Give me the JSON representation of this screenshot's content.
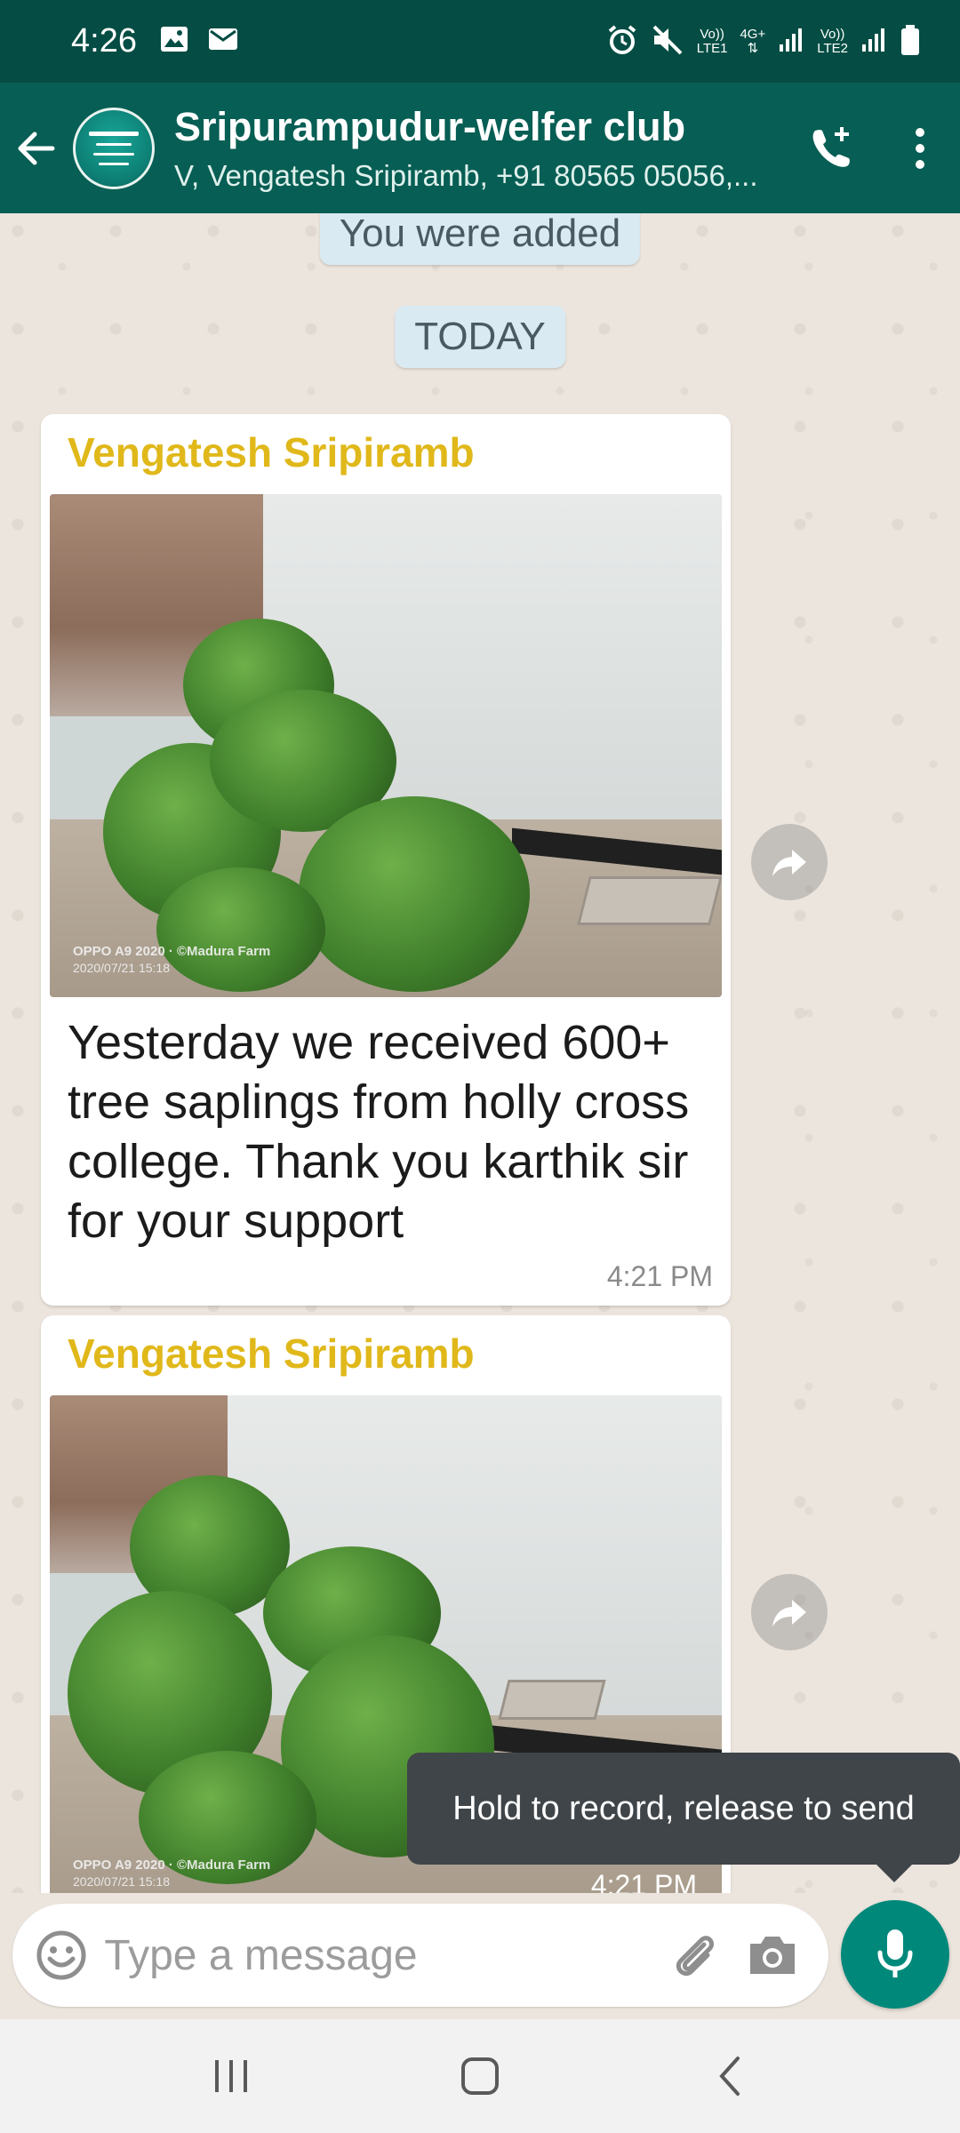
{
  "status_bar": {
    "time": "4:26",
    "left_icons": [
      "image-icon",
      "mail-icon"
    ],
    "right_icons": [
      "alarm-icon",
      "mute-icon",
      "signal-icon",
      "battery-icon"
    ],
    "sim1_top": "Vo))",
    "sim1_bottom": "LTE1",
    "net1": "4G+",
    "sim2_top": "Vo))",
    "sim2_bottom": "LTE2"
  },
  "header": {
    "group_name": "Sripurampudur-welfer club",
    "members": "V, Vengatesh Sripiramb, +91 80565 05056,...",
    "avatar_text": "ஸ்ரீபுரம் புதூர் தாங்களை அன்புடன் வரவேற்கிறது",
    "colors": {
      "status_bar": "#054d44",
      "app_bar": "#075e54",
      "accent": "#00897b"
    }
  },
  "chat": {
    "system_added": "You were added",
    "date_chip": "TODAY",
    "messages": [
      {
        "sender": "Vengatesh Sripiramb",
        "photo_stamp_line1": "OPPO A9 2020 · ©Madura Farm",
        "photo_stamp_line2": "2020/07/21 15:18",
        "body": "Yesterday we received 600+ tree saplings from holly cross college.  Thank you karthik sir for your support",
        "time": "4:21 PM"
      },
      {
        "sender": "Vengatesh Sripiramb",
        "photo_stamp_line1": "OPPO A9 2020 · ©Madura Farm",
        "photo_stamp_line2": "2020/07/21 15:18",
        "time": "4:21 PM"
      }
    ]
  },
  "tooltip": "Hold to record, release to send",
  "input": {
    "placeholder": "Type a message"
  }
}
